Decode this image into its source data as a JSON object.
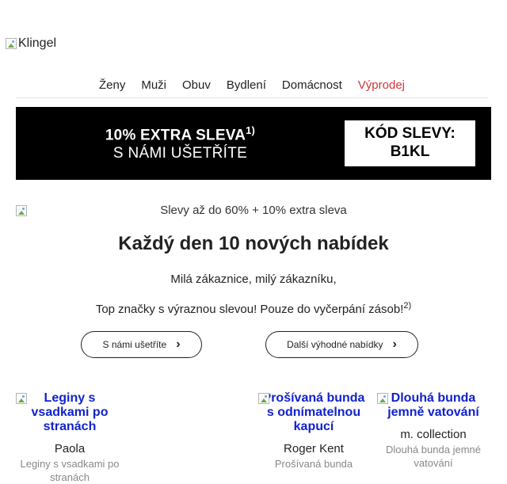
{
  "header": {
    "logo_alt": "Klingel"
  },
  "nav": {
    "items": [
      {
        "label": "Ženy"
      },
      {
        "label": "Muži"
      },
      {
        "label": "Obuv"
      },
      {
        "label": "Bydlení"
      },
      {
        "label": "Domácnost"
      },
      {
        "label": "Výprodej"
      }
    ],
    "sale_color": "#d0343a"
  },
  "banner": {
    "line1": "10% EXTRA SLEVA",
    "line1_sup": "1)",
    "line2": "S NÁMI UŠETŘÍTE",
    "code_label": "KÓD SLEVY:",
    "code_value": "B1KL"
  },
  "hero": {
    "image_alt": "Slevy až do 60% + 10% extra sleva",
    "headline": "Každý den 10 nových nabídek",
    "greeting": "Milá zákaznice, milý zákazníku,",
    "description": "Top značky s výraznou slevou! Pouze do vyčerpání zásob!",
    "description_sup": "2)"
  },
  "buttons": {
    "save": "S námi ušetříte",
    "more": "Další výhodné nabídky",
    "chevron": "›"
  },
  "products": [
    {
      "title": "Leginy s vsadkami po stranách",
      "brand": "Paola",
      "desc": "Leginy s vsadkami po stranách"
    },
    {
      "title": "Prošívaná bunda s odnímatelnou kapucí",
      "brand": "Roger Kent",
      "desc": "Prošívaná bunda"
    },
    {
      "title": "Dlouhá bunda jemně vatování",
      "brand": "m. collection",
      "desc": "Dlouhá bunda jemné vatování"
    }
  ]
}
